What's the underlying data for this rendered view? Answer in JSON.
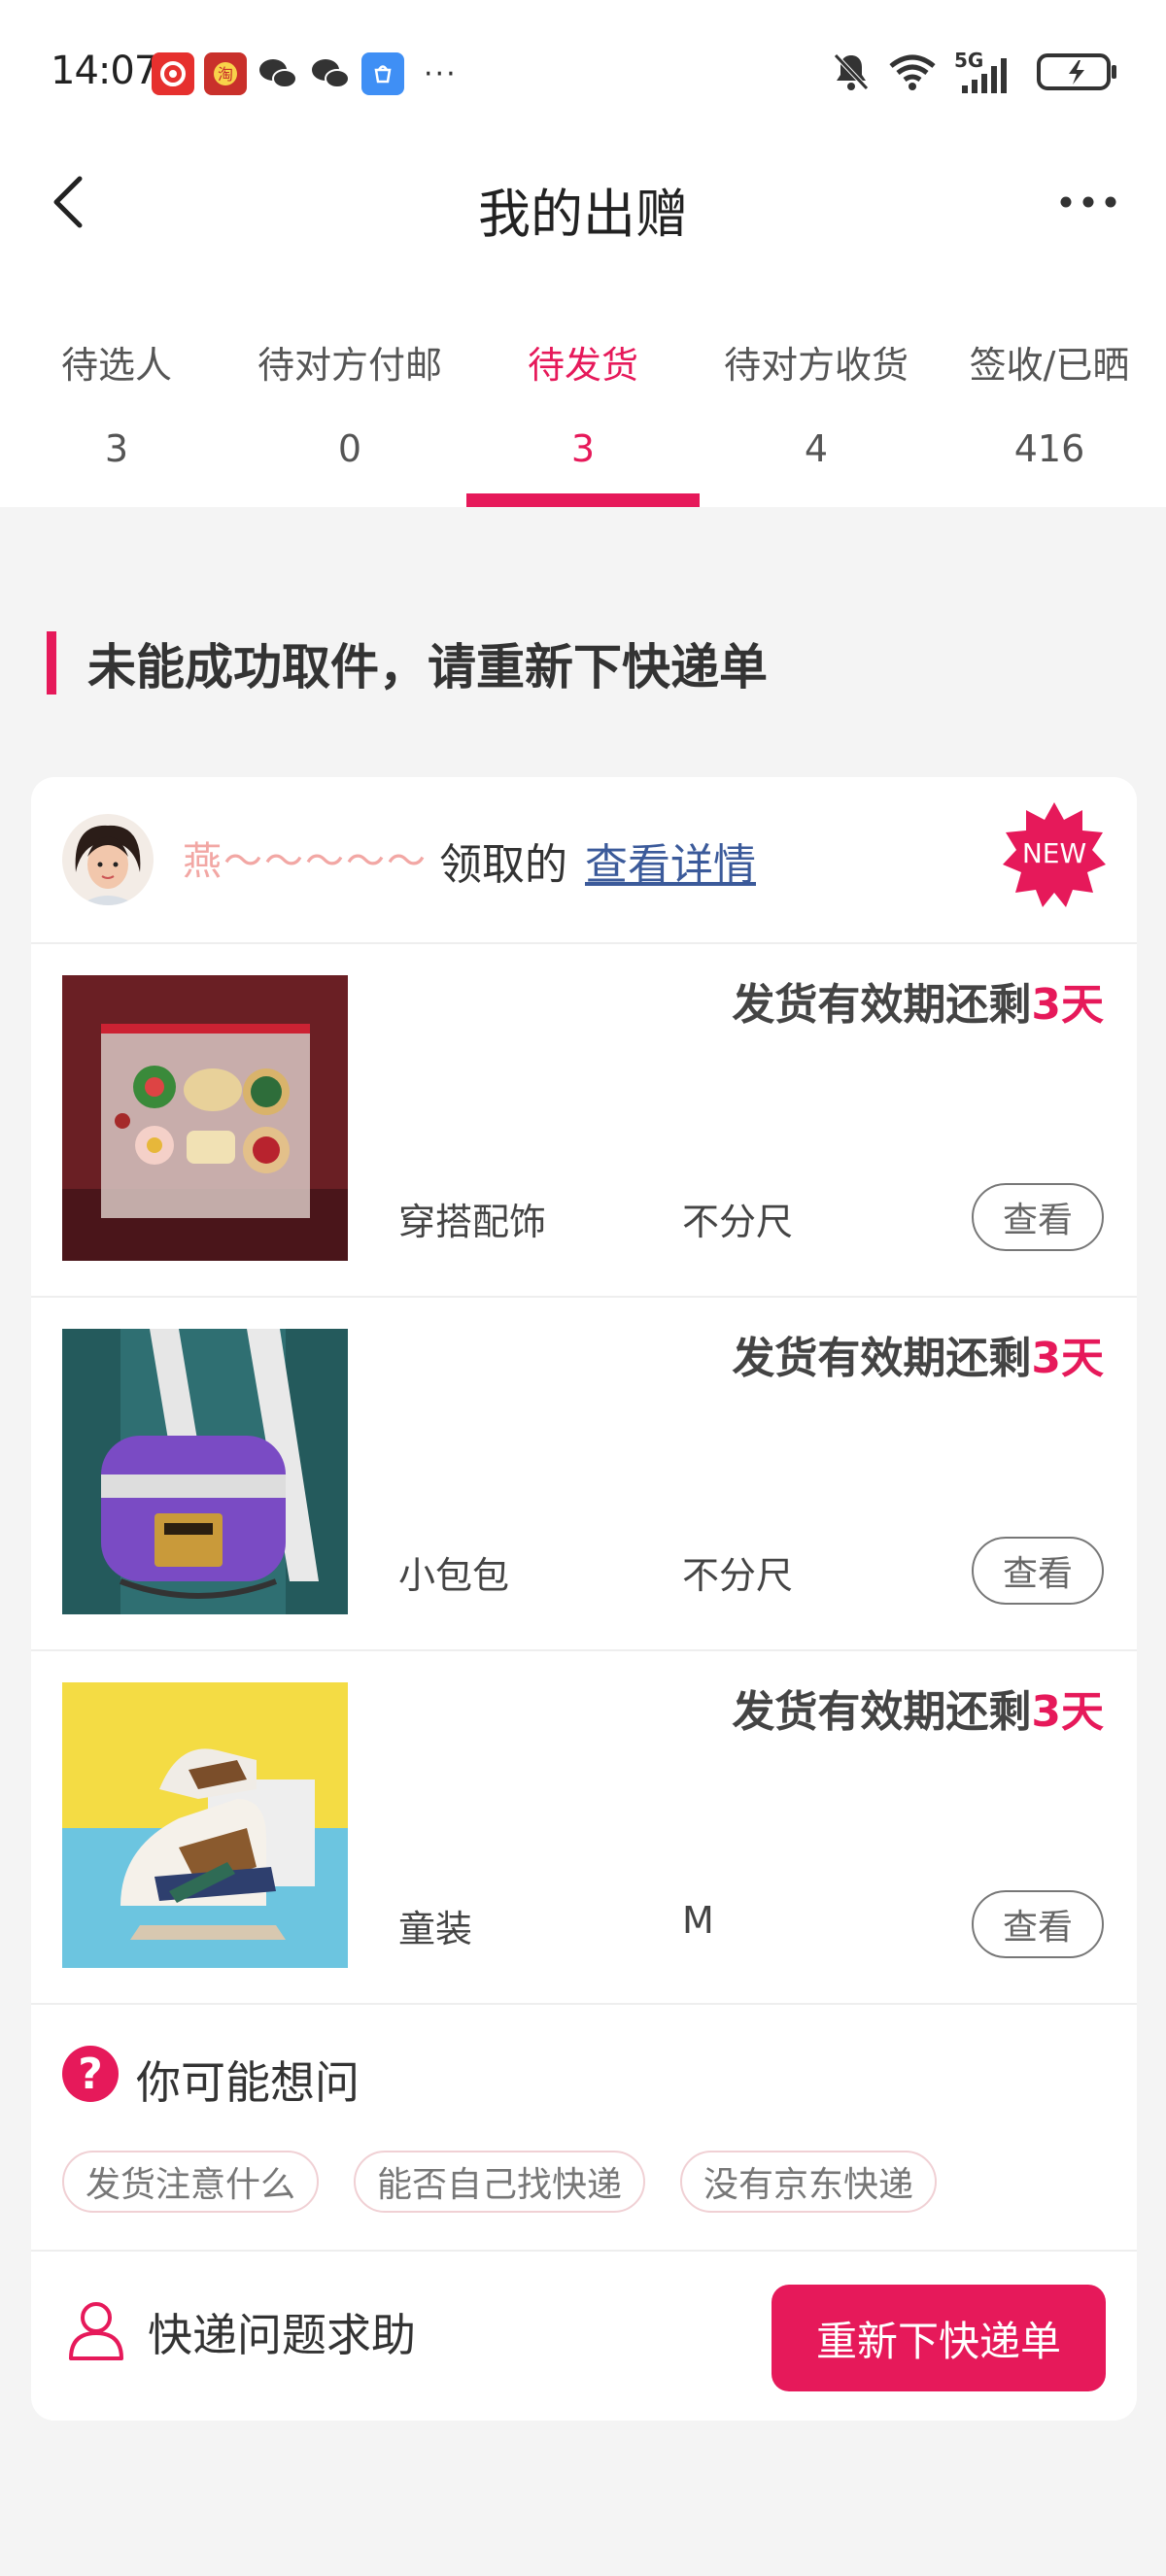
{
  "status_bar": {
    "time": "14:07",
    "network": "5G",
    "apps": [
      "pinduoduo-icon",
      "taobao-icon",
      "wechat-icon",
      "wechat-icon",
      "app-store-icon"
    ],
    "more": "···"
  },
  "header": {
    "title": "我的出赠",
    "back_icon": "chevron-left-icon",
    "more_icon": "more-dots-icon"
  },
  "tabs": [
    {
      "label": "待选人",
      "count": "3",
      "active": false
    },
    {
      "label": "待对方付邮",
      "count": "0",
      "active": false
    },
    {
      "label": "待发货",
      "count": "3",
      "active": true
    },
    {
      "label": "待对方收货",
      "count": "4",
      "active": false
    },
    {
      "label": "签收/已晒",
      "count": "416",
      "active": false
    }
  ],
  "notice": {
    "text": "未能成功取件，请重新下快递单"
  },
  "order": {
    "receiver_name": "燕～～～～～",
    "claimed_text": "领取的",
    "detail_link": "查看详情",
    "badge": "NEW",
    "items": [
      {
        "deadline_prefix": "发货有效期还剩",
        "deadline_value": "3天",
        "category": "穿搭配饰",
        "size": "不分尺",
        "view_label": "查看"
      },
      {
        "deadline_prefix": "发货有效期还剩",
        "deadline_value": "3天",
        "category": "小包包",
        "size": "不分尺",
        "view_label": "查看"
      },
      {
        "deadline_prefix": "发货有效期还剩",
        "deadline_value": "3天",
        "category": "童装",
        "size": "M",
        "view_label": "查看"
      }
    ]
  },
  "faq": {
    "title": "你可能想问",
    "icon_glyph": "?",
    "chips": [
      "发货注意什么",
      "能否自己找快递",
      "没有京东快递"
    ]
  },
  "footer": {
    "help_text": "快递问题求助",
    "primary_button": "重新下快递单"
  },
  "colors": {
    "accent": "#e6195a",
    "link": "#3b5a9a",
    "receiver_name": "#f2a7a4"
  }
}
